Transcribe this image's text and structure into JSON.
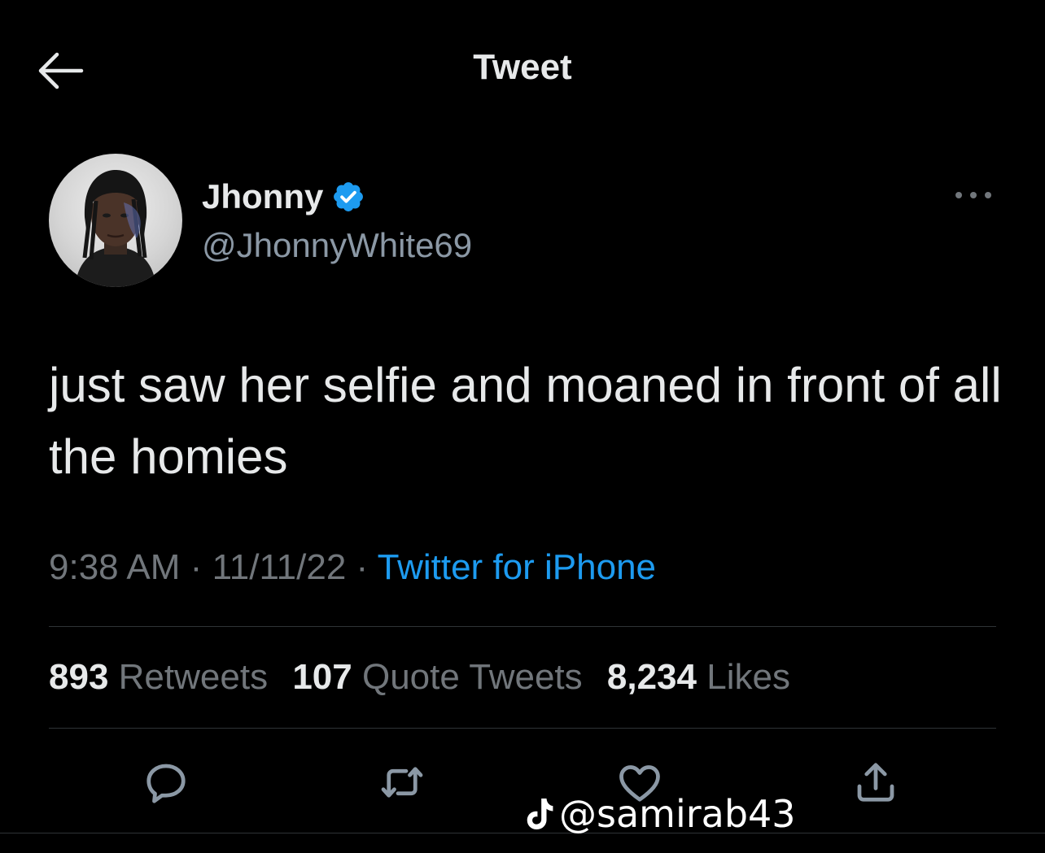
{
  "header": {
    "title": "Tweet",
    "back_icon": "arrow-left-icon"
  },
  "author": {
    "name": "Jhonny",
    "handle": "@JhonnyWhite69",
    "verified": true,
    "verified_color": "#1d9bf0"
  },
  "tweet": {
    "text": "just saw her selfie and moaned in front of all the homies",
    "time": "9:38 AM",
    "date": "11/11/22",
    "separator": "·",
    "source": "Twitter for iPhone"
  },
  "stats": {
    "retweets": {
      "count": "893",
      "label": "Retweets"
    },
    "quotes": {
      "count": "107",
      "label": "Quote Tweets"
    },
    "likes": {
      "count": "8,234",
      "label": "Likes"
    }
  },
  "actions": [
    "reply-icon",
    "retweet-icon",
    "like-icon",
    "share-icon"
  ],
  "watermark": {
    "text": "@samirab43",
    "icon": "tiktok-icon"
  },
  "colors": {
    "background": "#000000",
    "accent": "#1d9bf0",
    "muted": "#71767b",
    "text": "#e7e9ea"
  }
}
